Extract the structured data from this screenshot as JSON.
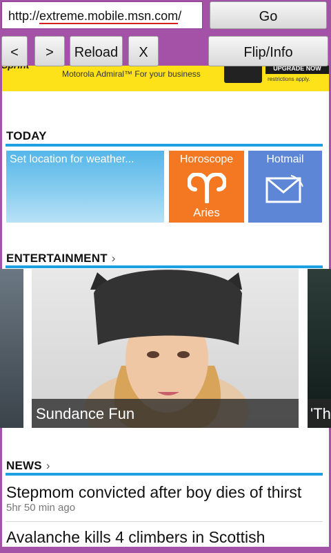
{
  "browser": {
    "url_prefix": "http://",
    "url_domain": "extreme.mobile.msn.com",
    "url_suffix": "/",
    "go_label": "Go",
    "back_label": "<",
    "forward_label": ">",
    "reload_label": "Reload",
    "stop_label": "X",
    "flip_label": "Flip/Info",
    "accent": "#a352a8"
  },
  "ad": {
    "brand": "Sprint",
    "tagline": "Motorola Admiral™ For your business",
    "cta": "UPGRADE NOW",
    "terms": "restrictions apply.",
    "background": "#fde21a"
  },
  "today": {
    "heading": "TODAY",
    "weather_label": "Set location for weather...",
    "horoscope_label": "Horoscope",
    "horoscope_sign": "Aries",
    "hotmail_label": "Hotmail",
    "colors": {
      "weather": "#6fc2ec",
      "horoscope": "#f47721",
      "hotmail": "#5d86d6"
    }
  },
  "entertainment": {
    "heading": "ENTERTAINMENT",
    "chevron": "›",
    "main_caption": "Sundance Fun",
    "next_caption": "'Th"
  },
  "news": {
    "heading": "NEWS",
    "chevron": "›",
    "items": [
      {
        "title": "Stepmom convicted after boy dies of thirst",
        "time": "5hr 50 min ago"
      },
      {
        "title": "Avalanche kills 4 climbers in Scottish",
        "time": ""
      }
    ]
  },
  "rule_color": "#1ba0e2"
}
